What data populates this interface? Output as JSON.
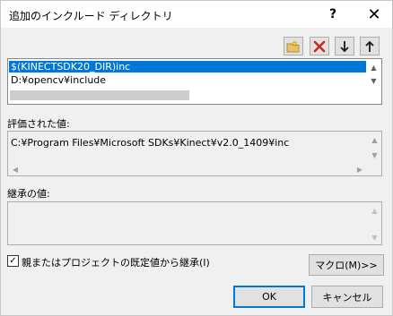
{
  "window": {
    "title": "追加のインクルード ディレクトリ",
    "help_label": "?",
    "close_label": "✕"
  },
  "toolbar": {
    "new_folder_icon": "new-folder-icon",
    "delete_icon": "delete-icon",
    "move_down_icon": "arrow-down-icon",
    "move_up_icon": "arrow-up-icon",
    "delete_color": "#c42b1c"
  },
  "list": {
    "items": [
      "$(KINECTSDK20_DIR)inc",
      "D:¥opencv¥include"
    ],
    "selected_index": 0,
    "selection_color": "#0078d7"
  },
  "evaluated": {
    "label": "評価された値:",
    "value": "C:¥Program Files¥Microsoft SDKs¥Kinect¥v2.0_1409¥inc"
  },
  "inherited": {
    "label": "継承の値:",
    "value": ""
  },
  "inherit_checkbox": {
    "label": "親またはプロジェクトの既定値から継承(I)",
    "checked": true
  },
  "buttons": {
    "macro": "マクロ(M)>>",
    "ok": "OK",
    "cancel": "キャンセル"
  }
}
